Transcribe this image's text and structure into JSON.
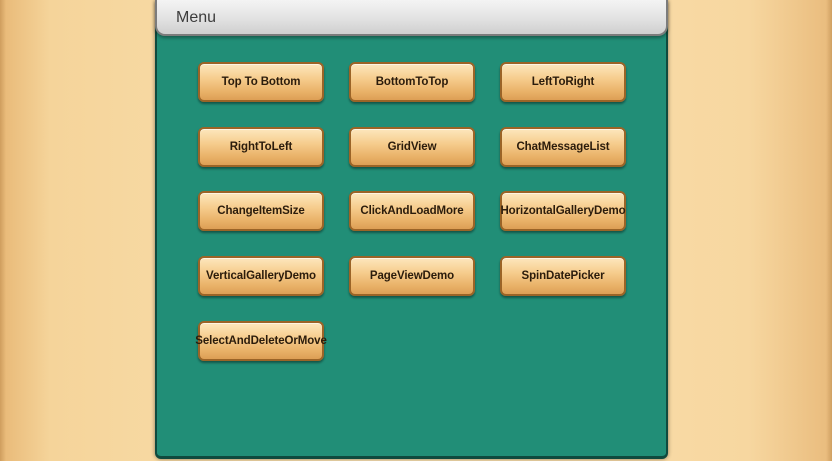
{
  "menu": {
    "title": "Menu",
    "buttons": [
      "Top To Bottom",
      "BottomToTop",
      "LeftToRight",
      "RightToLeft",
      "GridView",
      "ChatMessageList",
      "ChangeItemSize",
      "ClickAndLoadMore",
      "HorizontalGalleryDemo",
      "VerticalGalleryDemo",
      "PageViewDemo",
      "SpinDatePicker",
      "SelectAndDeleteOrMove"
    ]
  },
  "colors": {
    "panel_background": "#218e77",
    "button_face": "#f6cd8e",
    "button_border": "#9b6427",
    "page_background": "#fbe2b2",
    "header_background": "#e2e2e2"
  }
}
